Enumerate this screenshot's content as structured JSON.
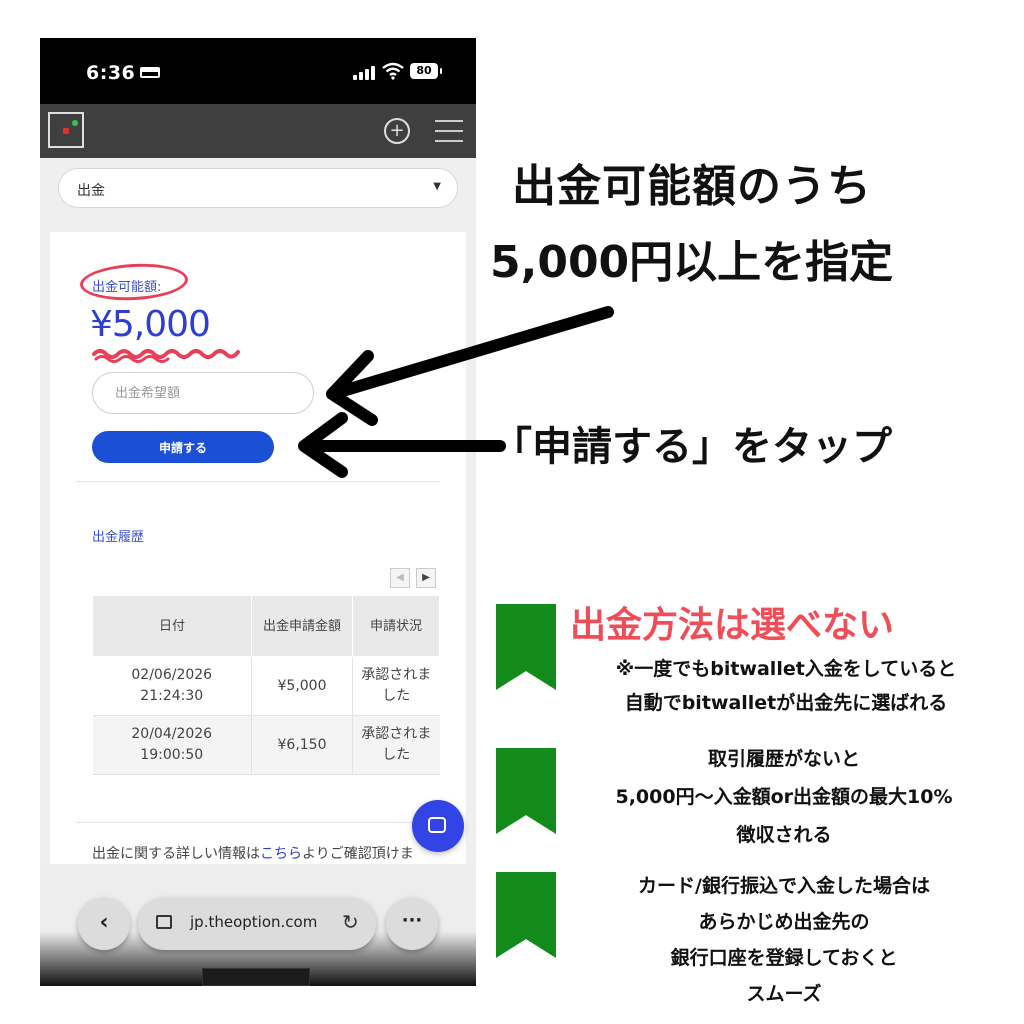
{
  "status_bar": {
    "time": "6:36",
    "battery": "80"
  },
  "nav": {
    "plus_label": "+"
  },
  "withdraw_select": {
    "value": "出金"
  },
  "withdraw_form": {
    "available_label": "出金可能額:",
    "available_amount": "¥5,000",
    "amount_placeholder": "出金希望額",
    "apply_label": "申請する"
  },
  "history": {
    "title": "出金履歴",
    "pager": {
      "prev": "◀",
      "next": "▶"
    },
    "columns": [
      "日付",
      "出金申請金額",
      "申請状況"
    ],
    "rows": [
      {
        "date": "02/06/2026",
        "time": "21:24:30",
        "amount": "¥5,000",
        "status": "承認されました"
      },
      {
        "date": "20/04/2026",
        "time": "19:00:50",
        "amount": "¥6,150",
        "status": "承認されました"
      }
    ]
  },
  "info": {
    "prefix": "出金に関する詳しい情報は",
    "link": "こちら",
    "suffix": "よりご確認頂けます。"
  },
  "browser": {
    "url": "jp.theoption.com",
    "back": "‹",
    "reload": "↻",
    "more": "···"
  },
  "annotations": {
    "headline_1": "出金可能額のうち",
    "headline_2": "5,000円以上を指定",
    "tap_instruction": "「申請する」をタップ",
    "cannot_choose": "出金方法は選べない",
    "note_1": [
      "※一度でもbitwallet入金をしていると",
      "自動でbitwalletが出金先に選ばれる"
    ],
    "note_2": [
      "取引履歴がないと",
      "5,000円〜入金額or出金額の最大10%",
      "徴収される"
    ],
    "note_3": [
      "カード/銀行振込で入金した場合は",
      "あらかじめ出金先の",
      "銀行口座を登録しておくと",
      "スムーズ"
    ]
  },
  "colors": {
    "accent_blue": "#1a4fd6",
    "highlight_red": "#e8405a",
    "bookmark_green": "#138a1c",
    "warning_red": "#ef4d57"
  }
}
